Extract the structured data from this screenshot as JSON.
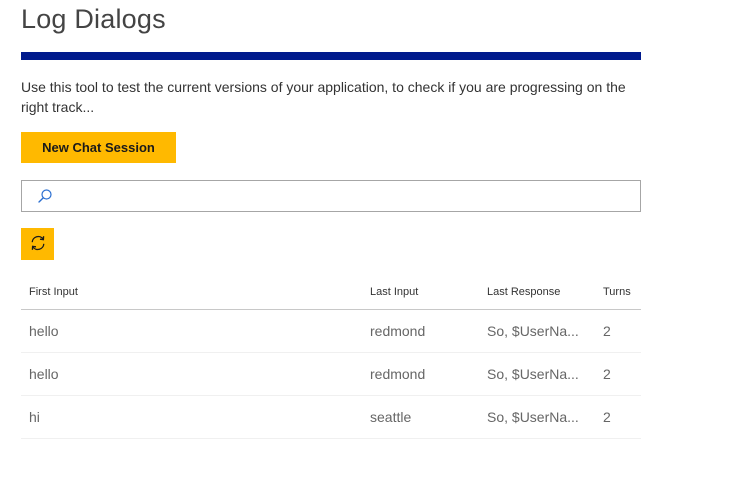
{
  "page": {
    "title": "Log Dialogs",
    "description": "Use this tool to test the current versions of your application, to check if you are progressing on the right track..."
  },
  "toolbar": {
    "new_session_label": "New Chat Session",
    "search_placeholder": "",
    "search_icon": "search-icon",
    "refresh_icon": "refresh-icon"
  },
  "colors": {
    "accent_bar": "#001a8c",
    "button": "#ffb900"
  },
  "table": {
    "headers": {
      "first_input": "First Input",
      "last_input": "Last Input",
      "last_response": "Last Response",
      "turns": "Turns"
    },
    "rows": [
      {
        "first_input": "hello",
        "last_input": "redmond",
        "last_response": "So, $UserNa...",
        "turns": "2"
      },
      {
        "first_input": "hello",
        "last_input": "redmond",
        "last_response": "So, $UserNa...",
        "turns": "2"
      },
      {
        "first_input": "hi",
        "last_input": "seattle",
        "last_response": "So, $UserNa...",
        "turns": "2"
      }
    ]
  }
}
